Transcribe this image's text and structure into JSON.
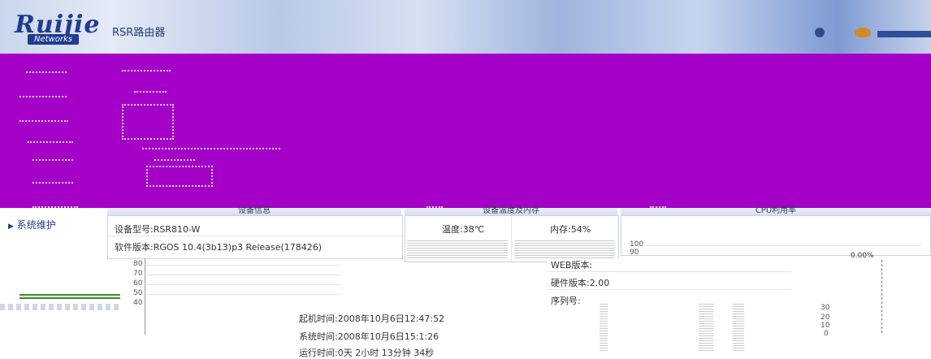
{
  "header": {
    "logo_text": "Ruijie",
    "logo_sub": "Networks",
    "product_title": "RSR路由器"
  },
  "sidebar": {
    "items": [
      {
        "label": "系统维护"
      }
    ]
  },
  "panels": {
    "device_info": {
      "title": "设备信息",
      "model": "设备型号:RSR810-W",
      "software": "软件版本:RGOS 10.4(3b13)p3 Release(178426)",
      "web_version": "WEB版本:",
      "hardware": "硬件版本:2.00",
      "serial": "序列号:",
      "boot_time": "起机时间:2008年10月6日12:47:52",
      "system_time": "系统时间:2008年10月6日15:1:26",
      "uptime": "运行时间:0天 2小时 13分钟 34秒"
    },
    "temp_mem": {
      "title": "设备温度及内存",
      "temperature": "温度:38℃",
      "memory": "内存:54%"
    },
    "cpu": {
      "title": "CPU利用率",
      "value_label": "0.00%"
    }
  },
  "chart_data": {
    "type": "line",
    "title": "CPU利用率",
    "y_ticks": [
      "100",
      "90",
      "80",
      "70",
      "60",
      "50",
      "40",
      "30",
      "20",
      "10",
      "0"
    ],
    "ylim": [
      0,
      100
    ],
    "series": [
      {
        "values": [
          0,
          0,
          0,
          0,
          0,
          0
        ]
      }
    ]
  }
}
